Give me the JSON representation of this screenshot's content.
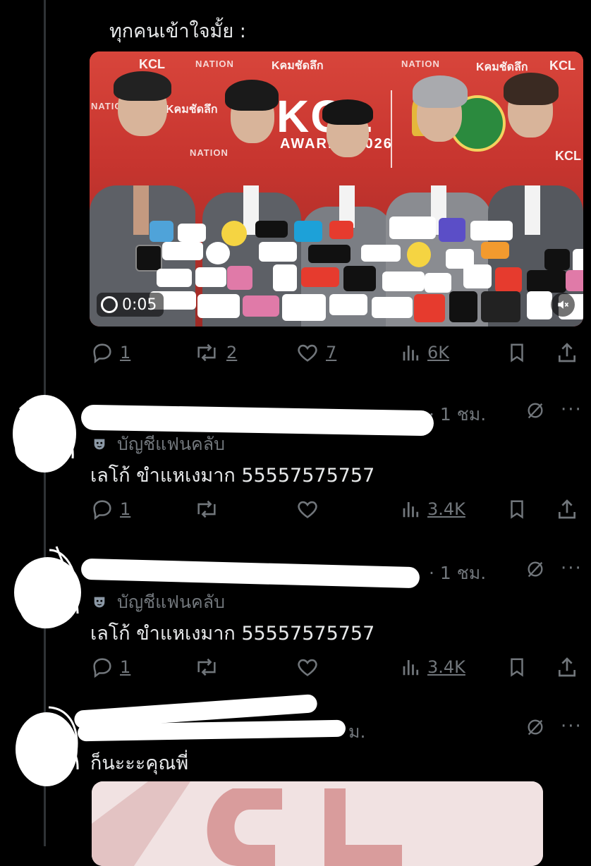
{
  "post": {
    "caption": "ทุกคนเข้าใจมั้ย :",
    "video": {
      "timestamp": "0:05",
      "backdrop_title": "KCL",
      "backdrop_subtitle": "AWARDS 2026",
      "backdrop_brands": [
        "KCL",
        "NATION",
        "Kคมชัดลึก"
      ]
    },
    "actions": {
      "replies": "1",
      "reposts": "2",
      "likes": "7",
      "views": "6K"
    }
  },
  "replies": [
    {
      "time": "· 1 ชม.",
      "badge": "บัญชีแฟนคลับ",
      "text": "เลโก้ ขำแหเงมาก 55557575757",
      "actions": {
        "replies": "1",
        "reposts": "",
        "likes": "",
        "views": "3.4K"
      }
    },
    {
      "time": "· 1 ชม.",
      "badge": "บัญชีแฟนคลับ",
      "text": "เลโก้ ขำแหเงมาก 55557575757",
      "actions": {
        "replies": "1",
        "reposts": "",
        "likes": "",
        "views": "3.4K"
      }
    },
    {
      "time": "ม.",
      "text": "ก็นะะะคุณพี่"
    }
  ],
  "icons": {
    "reply": "reply-icon",
    "repost": "repost-icon",
    "like": "heart-icon",
    "views": "views-icon",
    "bookmark": "bookmark-icon",
    "share": "share-icon",
    "grok": "grok-icon",
    "more": "more-icon"
  },
  "colors": {
    "background": "#000000",
    "text": "#e7e9ea",
    "muted": "#71767b",
    "divider": "#2f3336"
  }
}
